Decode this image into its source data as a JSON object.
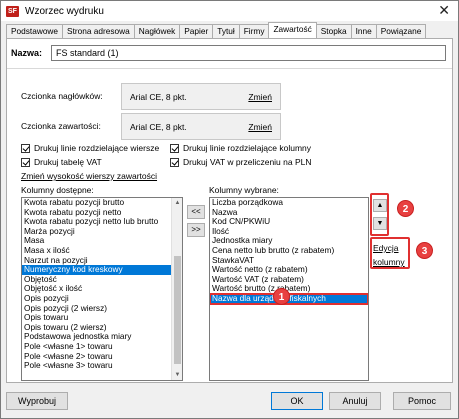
{
  "window": {
    "title": "Wzorzec wydruku",
    "app_icon": "SF",
    "close_glyph": "✕"
  },
  "tabs": [
    {
      "label": "Podstawowe"
    },
    {
      "label": "Strona adresowa"
    },
    {
      "label": "Nagłówek"
    },
    {
      "label": "Papier"
    },
    {
      "label": "Tytuł"
    },
    {
      "label": "Firmy"
    },
    {
      "label": "Zawartość",
      "active": true
    },
    {
      "label": "Stopka"
    },
    {
      "label": "Inne"
    },
    {
      "label": "Powiązane"
    }
  ],
  "name": {
    "label": "Nazwa:",
    "value": "FS standard (1)"
  },
  "fonts": {
    "header": {
      "label": "Czcionka nagłówków:",
      "value": "Arial CE, 8 pkt.",
      "change": "Zmień"
    },
    "content": {
      "label": "Czcionka zawartości:",
      "value": "Arial CE, 8 pkt.",
      "change": "Zmień"
    }
  },
  "options": {
    "lines_rows": "Drukuj linie rozdzielające wiersze",
    "lines_cols": "Drukuj linie rozdzielające kolumny",
    "vat_table": "Drukuj tabelę VAT",
    "vat_pln": "Drukuj VAT w przeliczeniu na PLN",
    "row_height_link": "Zmień wysokość wierszy zawartości"
  },
  "available": {
    "caption": "Kolumny dostępne:",
    "items": [
      "Kwota rabatu pozycji brutto",
      "Kwota rabatu pozycji netto",
      "Kwota rabatu pozycji netto lub brutto",
      "Marża pozycji",
      "Masa",
      "Masa x ilość",
      "Narzut na pozycji",
      "Numeryczny kod kreskowy",
      "Objętość",
      "Objętość x ilość",
      "Opis pozycji",
      "Opis pozycji (2 wiersz)",
      "Opis towaru",
      "Opis towaru (2 wiersz)",
      "Podstawowa jednostka miary",
      "Pole <własne 1> towaru",
      "Pole <własne 2> towaru",
      "Pole <własne 3> towaru"
    ],
    "selected_index": 7
  },
  "chosen": {
    "caption": "Kolumny wybrane:",
    "items": [
      "Liczba porządkowa",
      "Nazwa",
      "Kod CN/PKWiU",
      "Ilość",
      "Jednostka miary",
      "Cena netto lub brutto (z rabatem)",
      "StawkaVAT",
      "Wartość netto (z rabatem)",
      "Wartość VAT (z rabatem)",
      "Wartość brutto (z rabatem)",
      "Nazwa dla urządzeń fiskalnych"
    ],
    "selected_index": 10
  },
  "move": {
    "left": "<<",
    "right": ">>"
  },
  "order": {
    "up": "▲",
    "down": "▼"
  },
  "edit": {
    "line1": "Edycja",
    "line2": "kolumny"
  },
  "markers": {
    "m1": "1",
    "m2": "2",
    "m3": "3"
  },
  "footer": {
    "print": "Wyprobuj",
    "ok": "OK",
    "cancel": "Anuluj",
    "help": "Pomoc"
  },
  "colors": {
    "selection": "#0078d7",
    "highlight": "#e03030"
  }
}
